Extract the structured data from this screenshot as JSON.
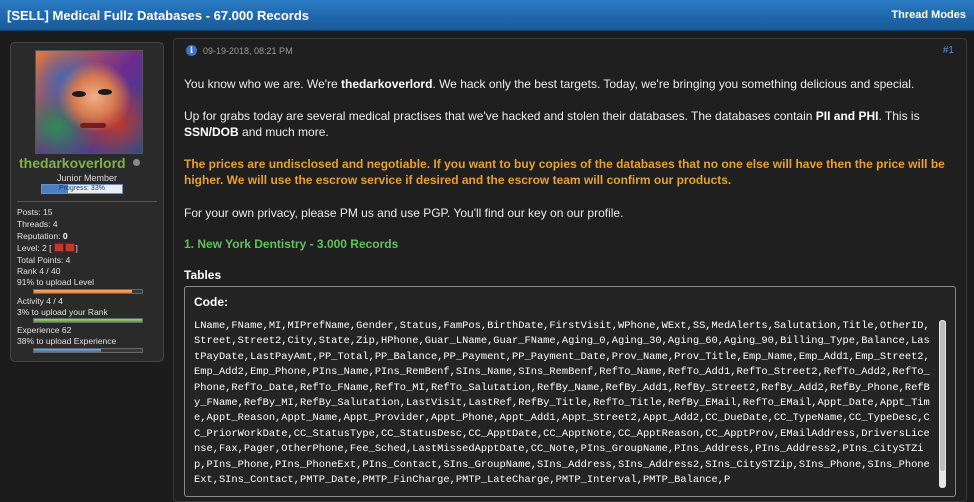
{
  "thread": {
    "title": "[SELL] Medical Fullz Databases - 67.000 Records",
    "modes_label": "Thread Modes"
  },
  "user": {
    "name": "thedarkoverlord",
    "title": "Junior Member",
    "progress_text": "Progress: 33%",
    "progress_value": 0.33,
    "posts": "Posts: 15",
    "threads": "Threads: 4",
    "reputation_label": "Reputation:",
    "reputation_value": "0",
    "level_label": "Level: 2 [",
    "level_close": "]",
    "total_points": "Total Points: 4",
    "rank": "Rank 4 / 40",
    "upload_level": "91% to upload Level",
    "upload_level_value": 0.91,
    "activity": "Activity 4 / 4",
    "upload_rank": "3% to upload your Rank",
    "upload_rank_value": 1.0,
    "experience": "Experience 62",
    "upload_experience": "38% to upload Experience",
    "upload_experience_value": 0.62
  },
  "post": {
    "date": "09-19-2018, 08:21 PM",
    "number": "#1",
    "p1_a": "You know who we are. We're ",
    "p1_b": "thedarkoverlord",
    "p1_c": ". We hack only the best targets. Today, we're bringing you something delicious and special.",
    "p2_a": "Up for grabs today are several medical practises that we've hacked and stolen their databases. The databases contain ",
    "p2_b": "PII and PHI",
    "p2_c": ". This is ",
    "p2_d": "SSN/DOB",
    "p2_e": " and much more.",
    "p3": "The prices are undisclosed and negotiable. If you want to buy copies of the databases that no one else will have then the price will be higher. We will use the escrow service if desired and the escrow team will confirm our products.",
    "p4": "For your own privacy, please PM us and use PGP. You'll find our key on our profile.",
    "heading1": "1. New York Dentistry - 3.000 Records",
    "tables_label": "Tables",
    "code_label": "Code:",
    "code_text": "LName,FName,MI,MIPrefName,Gender,Status,FamPos,BirthDate,FirstVisit,WPhone,WExt,SS,MedAlerts,Salutation,Title,OtherID,Street,Street2,City,State,Zip,HPhone,Guar_LName,Guar_FName,Aging_0,Aging_30,Aging_60,Aging_90,Billing_Type,Balance,LastPayDate,LastPayAmt,PP_Total,PP_Balance,PP_Payment,PP_Payment_Date,Prov_Name,Prov_Title,Emp_Name,Emp_Add1,Emp_Street2,Emp_Add2,Emp_Phone,PIns_Name,PIns_RemBenf,SIns_Name,SIns_RemBenf,RefTo_Name,RefTo_Add1,RefTo_Street2,RefTo_Add2,RefTo_Phone,RefTo_Date,RefTo_FName,RefTo_MI,RefTo_Salutation,RefBy_Name,RefBy_Add1,RefBy_Street2,RefBy_Add2,RefBy_Phone,RefBy_FName,RefBy_MI,RefBy_Salutation,LastVisit,LastRef,RefBy_Title,RefTo_Title,RefBy_EMail,RefTo_EMail,Appt_Date,Appt_Time,Appt_Reason,Appt_Name,Appt_Provider,Appt_Phone,Appt_Add1,Appt_Street2,Appt_Add2,CC_DueDate,CC_TypeName,CC_TypeDesc,CC_PriorWorkDate,CC_StatusType,CC_StatusDesc,CC_ApptDate,CC_ApptNote,CC_ApptReason,CC_ApptProv,EMailAddress,DriversLicense,Fax,Pager,OtherPhone,Fee_Sched,LastMissedApptDate,CC_Note,PIns_GroupName,PIns_Address,PIns_Address2,PIns_CitySTZip,PIns_Phone,PIns_PhoneExt,PIns_Contact,SIns_GroupName,SIns_Address,SIns_Address2,SIns_CitySTZip,SIns_Phone,SIns_PhoneExt,SIns_Contact,PMTP_Date,PMTP_FinCharge,PMTP_LateCharge,PMTP_Interval,PMTP_Balance,P"
  },
  "colors": {
    "title_bar": "#1f66a9",
    "username": "#7fb24a",
    "orange_text": "#e8a12e",
    "green_heading": "#62c15b",
    "post_link": "#4d8fd6"
  },
  "icons": [
    "info-icon",
    "online-status-icon",
    "rank-icon"
  ]
}
